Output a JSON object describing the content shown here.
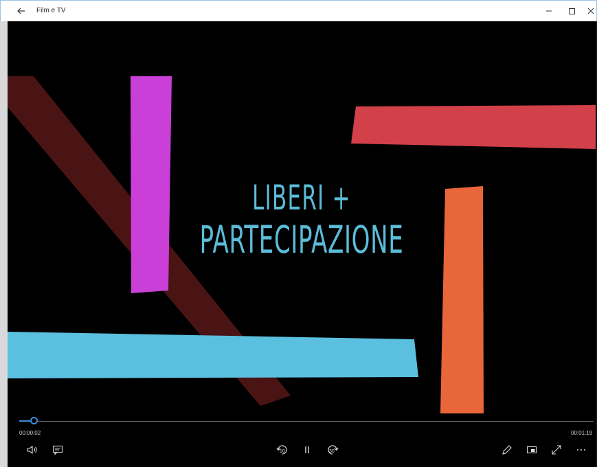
{
  "window": {
    "title": "Film e TV",
    "back_icon": "back-arrow-icon",
    "minimize_icon": "minimize-icon",
    "maximize_icon": "maximize-icon",
    "close_icon": "close-icon"
  },
  "video": {
    "title_line1": "LIBERI +",
    "title_line2": "PARTECIPAZIONE",
    "title_color": "#5bbcd8",
    "shape_colors": {
      "dark_red": "#4a1414",
      "magenta": "#c93fd8",
      "red": "#d2404a",
      "orange": "#e8663a",
      "cyan": "#5bbfe0"
    }
  },
  "player": {
    "current_time": "00:00:02",
    "total_time": "00:01:19",
    "progress": 0.025,
    "accent": "#3b8fd9",
    "skip_back_label": "10",
    "skip_forward_label": "30",
    "left_controls": [
      "volume-icon",
      "subtitles-icon"
    ],
    "center_controls": [
      "skip-back-10-icon",
      "pause-icon",
      "skip-forward-30-icon"
    ],
    "right_controls": [
      "edit-pen-icon",
      "mini-view-icon",
      "fullscreen-icon",
      "more-icon"
    ]
  }
}
